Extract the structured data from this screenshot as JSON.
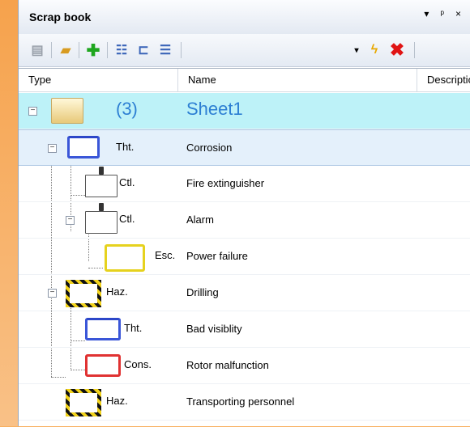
{
  "panel": {
    "title": "Scrap book",
    "controls": [
      "▾",
      "ᵖ",
      "×"
    ]
  },
  "toolbar": {
    "icons": [
      "paste-icon",
      "open-folder-icon",
      "add-icon",
      "tree-add-icon",
      "tree-link-icon",
      "tree-alert-icon",
      "dropdown-icon",
      "lightning-icon",
      "delete-icon"
    ]
  },
  "columns": {
    "type": "Type",
    "name": "Name",
    "description": "Descriptio"
  },
  "rows": [
    {
      "kind": "",
      "count": "(3)",
      "name": "Sheet1"
    },
    {
      "kind": "Tht.",
      "name": "Corrosion"
    },
    {
      "kind": "Ctl.",
      "name": "Fire extinguisher"
    },
    {
      "kind": "Ctl.",
      "name": "Alarm"
    },
    {
      "kind": "Esc.",
      "name": "Power failure"
    },
    {
      "kind": "Haz.",
      "name": "Drilling"
    },
    {
      "kind": "Tht.",
      "name": "Bad visiblity"
    },
    {
      "kind": "Cons.",
      "name": "Rotor malfunction"
    },
    {
      "kind": "Haz.",
      "name": "Transporting personnel"
    }
  ],
  "colors": {
    "threat": "#3a56d8",
    "escalation": "#e6d21e",
    "consequence": "#e03232",
    "hazard": "#f1d21a",
    "sheet_row": "#bdf2f8",
    "selected_row": "#e4f0fb"
  }
}
